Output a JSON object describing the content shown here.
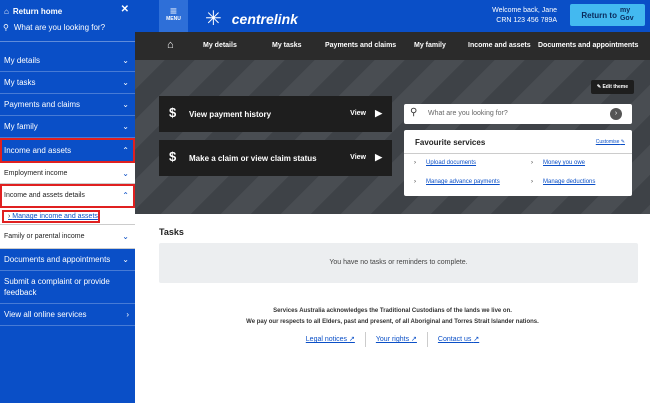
{
  "sidebar": {
    "return_label": "Return home",
    "search_placeholder": "What are you looking for?",
    "items": [
      {
        "label": "My details"
      },
      {
        "label": "My tasks"
      },
      {
        "label": "Payments and claims"
      },
      {
        "label": "My family"
      },
      {
        "label": "Income and assets"
      }
    ],
    "sub_items": {
      "employment": "Employment income",
      "details": "Income and assets details",
      "manage_link": "Manage income and assets",
      "family": "Family or parental income"
    },
    "more_items": {
      "docs": "Documents and appointments",
      "complaint": "Submit a complaint or provide feedback",
      "online": "View all online services"
    }
  },
  "header": {
    "menu_label": "MENU",
    "brand": "centrelink",
    "welcome": "Welcome back, Jane",
    "crn": "CRN 123 456 789A",
    "return_to": "Return to",
    "mygov_top": "my",
    "mygov_bottom": "Gov"
  },
  "nav": {
    "items": [
      "My details",
      "My tasks",
      "Payments and claims",
      "My family",
      "Income and assets",
      "Documents and appointments"
    ]
  },
  "hero": {
    "edit_theme": "Edit theme",
    "actions": [
      {
        "label": "View payment history",
        "view": "View"
      },
      {
        "label": "Make a claim or view claim status",
        "view": "View"
      }
    ],
    "search_placeholder": "What are you looking for?",
    "favourites": {
      "title": "Favourite services",
      "customise": "Customise",
      "links": [
        "Upload documents",
        "Money you owe",
        "Manage advance payments",
        "Manage deductions"
      ]
    }
  },
  "tasks": {
    "title": "Tasks",
    "empty": "You have no tasks or reminders to complete."
  },
  "footer": {
    "ack_line1": "Services Australia acknowledges the Traditional Custodians of the lands we live on.",
    "ack_line2": "We pay our respects to all Elders, past and present, of all Aboriginal and Torres Strait Islander nations.",
    "links": [
      "Legal notices",
      "Your rights",
      "Contact us"
    ]
  }
}
